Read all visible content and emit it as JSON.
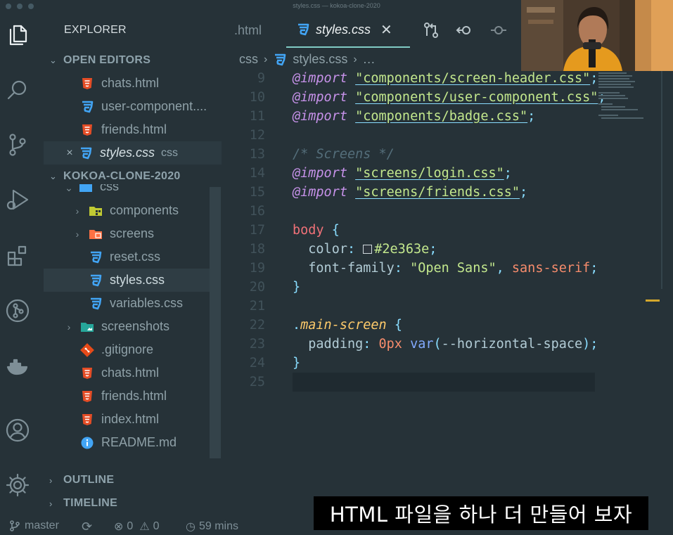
{
  "window": {
    "title": "styles.css — kokoa-clone-2020"
  },
  "activity_bar": {
    "items": [
      {
        "icon": "files-icon",
        "active": true
      },
      {
        "icon": "search-icon"
      },
      {
        "icon": "source-control-icon"
      },
      {
        "icon": "run-debug-icon"
      },
      {
        "icon": "extensions-icon"
      },
      {
        "icon": "git-graph-icon"
      },
      {
        "icon": "docker-icon"
      },
      {
        "icon": "account-icon"
      },
      {
        "icon": "settings-gear-icon"
      }
    ]
  },
  "sidebar": {
    "title": "EXPLORER",
    "open_editors": {
      "label": "OPEN EDITORS",
      "items": [
        {
          "name": "chats.html",
          "icon": "html-file-icon"
        },
        {
          "name": "user-component....",
          "icon": "css-file-icon"
        },
        {
          "name": "friends.html",
          "icon": "html-file-icon"
        },
        {
          "name": "styles.css",
          "folder": "css",
          "icon": "css-file-icon",
          "active": true
        }
      ]
    },
    "project": {
      "label": "KOKOA-CLONE-2020",
      "partial_folder": "css",
      "items": [
        {
          "name": "components",
          "icon": "components-folder-icon",
          "kind": "folder"
        },
        {
          "name": "screens",
          "icon": "screens-folder-icon",
          "kind": "folder"
        },
        {
          "name": "reset.css",
          "icon": "css-file-icon"
        },
        {
          "name": "styles.css",
          "icon": "css-file-icon",
          "selected": true
        },
        {
          "name": "variables.css",
          "icon": "css-file-icon"
        },
        {
          "name": "screenshots",
          "icon": "images-folder-icon",
          "kind": "folder"
        },
        {
          "name": ".gitignore",
          "icon": "git-file-icon"
        },
        {
          "name": "chats.html",
          "icon": "html-file-icon"
        },
        {
          "name": "friends.html",
          "icon": "html-file-icon"
        },
        {
          "name": "index.html",
          "icon": "html-file-icon"
        },
        {
          "name": "README.md",
          "icon": "info-file-icon"
        }
      ]
    },
    "outline_label": "OUTLINE",
    "timeline_label": "TIMELINE"
  },
  "tabs": [
    {
      "label": ".html"
    },
    {
      "label": "styles.css",
      "active": true
    }
  ],
  "breadcrumb": {
    "folder": "css",
    "file": "styles.css",
    "more": "…"
  },
  "editor": {
    "lines": [
      {
        "n": "9",
        "tokens": [
          {
            "c": "kw",
            "t": "@import"
          },
          {
            "c": "sp",
            "t": " "
          },
          {
            "c": "str",
            "t": "\"components/screen-header.css\""
          },
          {
            "c": "pun",
            "t": ";"
          }
        ]
      },
      {
        "n": "10",
        "tokens": [
          {
            "c": "kw",
            "t": "@import"
          },
          {
            "c": "sp",
            "t": " "
          },
          {
            "c": "str",
            "t": "\"components/user-component.css\""
          },
          {
            "c": "pun",
            "t": ";"
          }
        ]
      },
      {
        "n": "11",
        "tokens": [
          {
            "c": "kw",
            "t": "@import"
          },
          {
            "c": "sp",
            "t": " "
          },
          {
            "c": "str",
            "t": "\"components/badge.css\""
          },
          {
            "c": "pun",
            "t": ";"
          }
        ]
      },
      {
        "n": "12",
        "tokens": []
      },
      {
        "n": "13",
        "tokens": [
          {
            "c": "com",
            "t": "/* Screens */"
          }
        ]
      },
      {
        "n": "14",
        "tokens": [
          {
            "c": "kw",
            "t": "@import"
          },
          {
            "c": "sp",
            "t": " "
          },
          {
            "c": "str",
            "t": "\"screens/login.css\""
          },
          {
            "c": "pun",
            "t": ";"
          }
        ]
      },
      {
        "n": "15",
        "tokens": [
          {
            "c": "kw",
            "t": "@import"
          },
          {
            "c": "sp",
            "t": " "
          },
          {
            "c": "str",
            "t": "\"screens/friends.css\""
          },
          {
            "c": "pun",
            "t": ";"
          }
        ]
      },
      {
        "n": "16",
        "tokens": []
      },
      {
        "n": "17",
        "tokens": [
          {
            "c": "sel2",
            "t": "body"
          },
          {
            "c": "sp",
            "t": " "
          },
          {
            "c": "pun",
            "t": "{"
          }
        ]
      },
      {
        "n": "18",
        "tokens": [
          {
            "c": "sp",
            "t": "  "
          },
          {
            "c": "prop",
            "t": "color"
          },
          {
            "c": "pun",
            "t": ": "
          },
          {
            "c": "swatch",
            "t": ""
          },
          {
            "c": "val",
            "t": "#2e363e"
          },
          {
            "c": "pun",
            "t": ";"
          }
        ]
      },
      {
        "n": "19",
        "tokens": [
          {
            "c": "sp",
            "t": "  "
          },
          {
            "c": "prop",
            "t": "font-family"
          },
          {
            "c": "pun",
            "t": ": "
          },
          {
            "c": "val",
            "t": "\"Open Sans\""
          },
          {
            "c": "pun",
            "t": ", "
          },
          {
            "c": "num",
            "t": "sans-serif"
          },
          {
            "c": "pun",
            "t": ";"
          }
        ]
      },
      {
        "n": "20",
        "tokens": [
          {
            "c": "pun",
            "t": "}"
          }
        ]
      },
      {
        "n": "21",
        "tokens": []
      },
      {
        "n": "22",
        "tokens": [
          {
            "c": "pun",
            "t": "."
          },
          {
            "c": "cls",
            "t": "main-screen"
          },
          {
            "c": "sp",
            "t": " "
          },
          {
            "c": "pun",
            "t": "{"
          }
        ]
      },
      {
        "n": "23",
        "tokens": [
          {
            "c": "sp",
            "t": "  "
          },
          {
            "c": "prop",
            "t": "padding"
          },
          {
            "c": "pun",
            "t": ": "
          },
          {
            "c": "num",
            "t": "0px"
          },
          {
            "c": "sp",
            "t": " "
          },
          {
            "c": "fn",
            "t": "var"
          },
          {
            "c": "pun",
            "t": "("
          },
          {
            "c": "prop",
            "t": "--horizontal-space"
          },
          {
            "c": "pun",
            "t": ");"
          }
        ]
      },
      {
        "n": "24",
        "tokens": [
          {
            "c": "pun",
            "t": "}"
          }
        ]
      },
      {
        "n": "25",
        "tokens": []
      }
    ]
  },
  "statusbar": {
    "branch": "master",
    "errors": "0",
    "warnings": "0",
    "time": "59 mins"
  },
  "subtitle": "HTML 파일을 하나 더 만들어 보자"
}
